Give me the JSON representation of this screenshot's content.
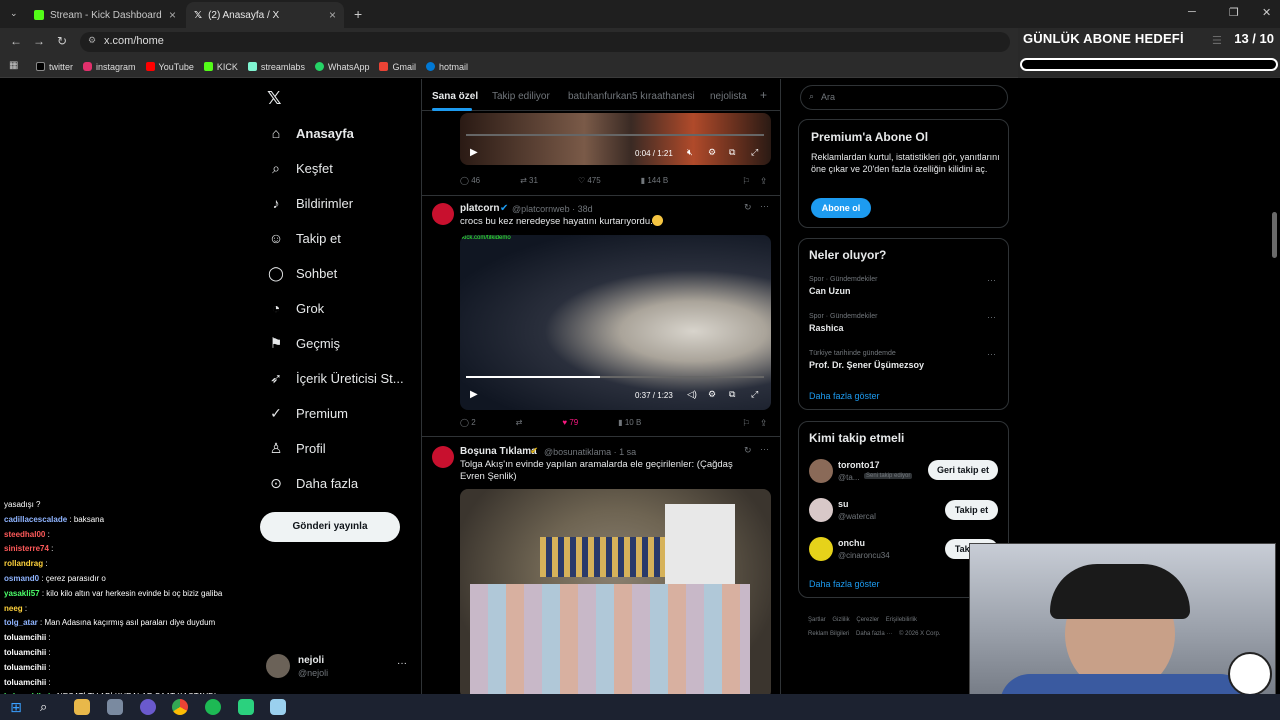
{
  "browser": {
    "tabs": [
      {
        "title": "Stream - Kick Dashboard",
        "active": false
      },
      {
        "title": "(2) Anasayfa / X",
        "active": true
      }
    ],
    "url": "x.com/home",
    "bookmarks": [
      "twitter",
      "instagram",
      "YouTube",
      "KICK",
      "streamlabs",
      "WhatsApp",
      "Gmail",
      "hotmail"
    ]
  },
  "overlay": {
    "goal_title": "GÜNLÜK ABONE HEDEFİ",
    "goal_count": "13 / 10"
  },
  "nav": {
    "items": [
      "Anasayfa",
      "Keşfet",
      "Bildirimler",
      "Takip et",
      "Sohbet",
      "Grok",
      "Geçmiş",
      "İçerik Üreticisi St...",
      "Premium",
      "Profil",
      "Daha fazla"
    ],
    "post_button": "Gönderi yayınla",
    "account_name": "nejoli",
    "account_handle": "@nejoli"
  },
  "feed": {
    "tabs": [
      "Sana özel",
      "Takip ediliyor",
      "batuhanfurkan5 kıraathanesi",
      "nejolista"
    ],
    "top_video": {
      "time": "0:04 / 1:21",
      "replies": "46",
      "reposts": "31",
      "likes": "475",
      "views": "144 B"
    },
    "tweets": [
      {
        "name": "platcorn",
        "handle": "@platcornweb · 38d",
        "text": "crocs bu kez neredeyse hayatını kurtarıyordu...",
        "video_time": "0:37 / 1:23",
        "replies": "2",
        "reposts": "",
        "likes": "79",
        "views": "10 B",
        "video_caption": "kick.com/tilkidemo"
      },
      {
        "name": "Boşuna Tıklama",
        "handle": "@bosunatiklama · 1 sa",
        "text": "Tolga Akış'ın evinde yapılan aramalarda ele geçirilenler: (Çağdaş Evren Şenlik)"
      }
    ]
  },
  "right": {
    "search_placeholder": "Ara",
    "premium": {
      "title": "Premium'a Abone Ol",
      "text": "Reklamlardan kurtul, istatistikleri gör, yanıtlarını öne çıkar ve 20'den fazla özelliğin kilidini aç.",
      "button": "Abone ol"
    },
    "trends_title": "Neler oluyor?",
    "trends": [
      {
        "meta": "Spor · Gündemdekiler",
        "name": "Can Uzun"
      },
      {
        "meta": "Spor · Gündemdekiler",
        "name": "Rashica"
      },
      {
        "meta": "Türkiye tarihinde gündemde",
        "name": "Prof. Dr. Şener Üşümezsoy"
      }
    ],
    "show_more": "Daha fazla göster",
    "who_title": "Kimi takip etmeli",
    "who": [
      {
        "name": "toronto17",
        "handle": "@ta...",
        "badge": "Seni takip ediyor",
        "button": "Geri takip et"
      },
      {
        "name": "su",
        "handle": "@watercal",
        "button": "Takip et"
      },
      {
        "name": "onchu",
        "handle": "@cinaroncu34",
        "button": "Takip et"
      }
    ],
    "footer": [
      "Şartlar",
      "Gizlilik",
      "Çerezler",
      "Erişilebilirlik",
      "Reklam Bilgileri",
      "Daha fazla ···",
      "© 2026 X Corp."
    ]
  },
  "chat": [
    {
      "user": "",
      "msg": "yasadışı ?",
      "color": "#ffffff"
    },
    {
      "user": "cadillacescalade",
      "msg": ": baksana",
      "color": "#8fb4ff"
    },
    {
      "user": "steedhal00",
      "msg": ":",
      "color": "#ff5a5a"
    },
    {
      "user": "sinisterre74",
      "msg": ":",
      "color": "#ff5a5a"
    },
    {
      "user": "rollandrag",
      "msg": ":",
      "color": "#ffd23c"
    },
    {
      "user": "osmand0",
      "msg": ": çerez parasıdır o",
      "color": "#8fb4ff"
    },
    {
      "user": "yasakli57",
      "msg": ": kilo kilo altın var herkesin evinde bi oç biziz galiba",
      "color": "#4cff6a"
    },
    {
      "user": "neeg",
      "msg": ":",
      "color": "#ffd23c"
    },
    {
      "user": "tolg_atar",
      "msg": ": Man Adasına kaçırmış asıl paraları diye duydum",
      "color": "#8fb4ff"
    },
    {
      "user": "toluamcihii",
      "msg": ":",
      "color": "#ffffff"
    },
    {
      "user": "toluamcihii",
      "msg": ":",
      "color": "#ffffff"
    },
    {
      "user": "toluamcihii",
      "msg": ":",
      "color": "#ffffff"
    },
    {
      "user": "toluamcihii",
      "msg": ":",
      "color": "#ffffff"
    },
    {
      "user": "kabus_hilmi",
      "msg": ": NECATİ TV ABİ KURALAR SAAT KAÇTAYDI",
      "color": "#4cff6a"
    }
  ]
}
